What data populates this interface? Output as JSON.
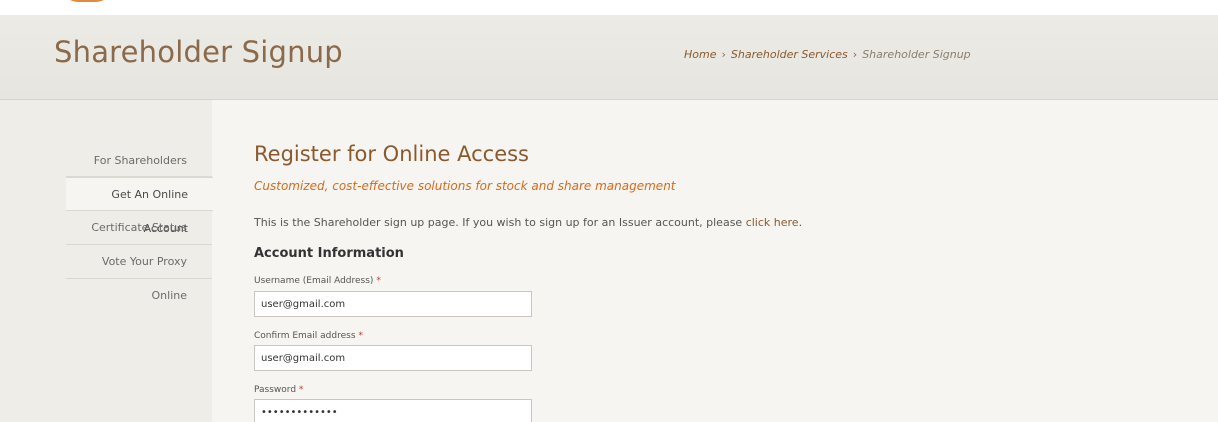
{
  "header": {
    "page_title": "Shareholder Signup",
    "breadcrumb": {
      "home": "Home",
      "separator": "›",
      "services": "Shareholder Services",
      "current": "Shareholder Signup"
    }
  },
  "sidebar": {
    "items": [
      {
        "label": "For Shareholders"
      },
      {
        "label": "Get An Online Account"
      },
      {
        "label": "Certificate Status"
      },
      {
        "label": "Vote Your Proxy Online"
      }
    ],
    "active_index": 1
  },
  "main": {
    "title": "Register for Online Access",
    "tagline": "Customized, cost-effective solutions for stock and share management",
    "intro_text": "This is the Shareholder sign up page. If you wish to sign up for an Issuer account, please ",
    "intro_link": "click here",
    "intro_end": ".",
    "account_heading": "Account Information",
    "required_mark": "*",
    "fields": {
      "username_label": "Username (Email Address)",
      "username_value": "user@gmail.com",
      "confirm_label": "Confirm Email address",
      "confirm_value": "user@gmail.com",
      "password_label": "Password",
      "password_value": "•••••••••••••"
    }
  },
  "colors": {
    "brand_brown": "#8a5a2e",
    "accent_orange": "#d76a1a",
    "required_red": "#c0392b"
  }
}
